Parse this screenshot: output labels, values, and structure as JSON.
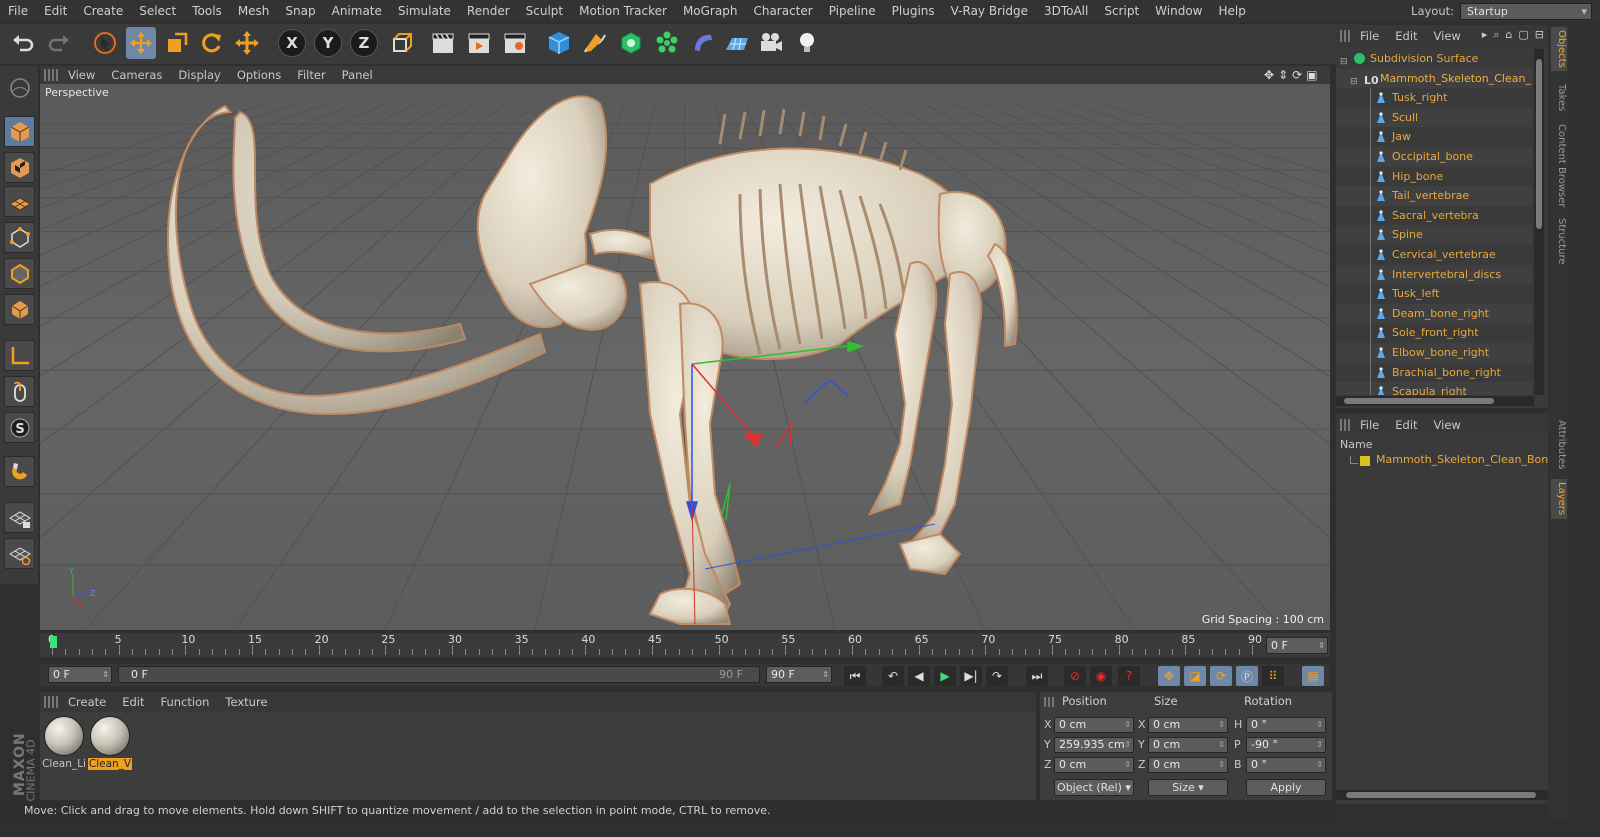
{
  "menubar": {
    "items": [
      "File",
      "Edit",
      "Create",
      "Select",
      "Tools",
      "Mesh",
      "Snap",
      "Animate",
      "Simulate",
      "Render",
      "Sculpt",
      "Motion Tracker",
      "MoGraph",
      "Character",
      "Pipeline",
      "Plugins",
      "V-Ray Bridge",
      "3DToAll",
      "Script",
      "Window",
      "Help"
    ],
    "layout_label": "Layout:",
    "layout_value": "Startup"
  },
  "toolbar": {
    "axis_x": "X",
    "axis_y": "Y",
    "axis_z": "Z"
  },
  "viewport": {
    "menu": [
      "View",
      "Cameras",
      "Display",
      "Options",
      "Filter",
      "Panel"
    ],
    "camera": "Perspective",
    "grid_spacing": "Grid Spacing : 100 cm",
    "axis_x": "X",
    "axis_y": "Y",
    "axis_z": "Z"
  },
  "timeline": {
    "ticks": [
      "0",
      "5",
      "10",
      "15",
      "20",
      "25",
      "30",
      "35",
      "40",
      "45",
      "50",
      "55",
      "60",
      "65",
      "70",
      "75",
      "80",
      "85",
      "90"
    ],
    "current_frame": "0 F"
  },
  "frames": {
    "start": "0 F",
    "slider_start": "0 F",
    "slider_end": "90 F",
    "end": "90 F"
  },
  "materials": {
    "menu": [
      "Create",
      "Edit",
      "Function",
      "Texture"
    ],
    "items": [
      {
        "name": "Clean_Li",
        "selected": false
      },
      {
        "name": "Clean_V",
        "selected": true
      }
    ]
  },
  "coords": {
    "headers": {
      "position": "Position",
      "size": "Size",
      "rotation": "Rotation"
    },
    "rows": [
      {
        "axis": "X",
        "pos": "0 cm",
        "size_axis": "X",
        "size": "0 cm",
        "rot_axis": "H",
        "rot": "0 °"
      },
      {
        "axis": "Y",
        "pos": "259.935 cm",
        "size_axis": "Y",
        "size": "0 cm",
        "rot_axis": "P",
        "rot": "-90 °"
      },
      {
        "axis": "Z",
        "pos": "0 cm",
        "size_axis": "Z",
        "size": "0 cm",
        "rot_axis": "B",
        "rot": "0 °"
      }
    ],
    "mode": "Object (Rel)",
    "size_mode": "Size",
    "apply": "Apply"
  },
  "status": "Move: Click and drag to move elements. Hold down SHIFT to quantize movement / add to the selection in point mode, CTRL to remove.",
  "brand": {
    "maxon": "MAXON",
    "product": "CINEMA 4D"
  },
  "objects": {
    "menu": [
      "File",
      "Edit",
      "View"
    ],
    "root": "Subdivision Surface",
    "group": "Mammoth_Skeleton_Clean_Bo",
    "children": [
      "Tusk_right",
      "Scull",
      "Jaw",
      "Occipital_bone",
      "Hip_bone",
      "Tail_vertebrae",
      "Sacral_vertebra",
      "Spine",
      "Cervical_vertebrae",
      "Intervertebral_discs",
      "Tusk_left",
      "Deam_bone_right",
      "Sole_front_right",
      "Elbow_bone_right",
      "Brachial_bone_right",
      "Scapula_right"
    ]
  },
  "layers": {
    "menu": [
      "File",
      "Edit",
      "View"
    ],
    "column": "Name",
    "item": "Mammoth_Skeleton_Clean_Bones",
    "layer_color": "#d6c41c"
  },
  "sidetabs": {
    "top": [
      "Objects",
      "Takes",
      "Content Browser",
      "Structure"
    ],
    "bottom": [
      "Attributes",
      "Layers"
    ]
  },
  "colors": {
    "accent": "#e8a83a",
    "selected_tool": "#6f88a8",
    "x_axis": "#e03030",
    "y_axis": "#30c030",
    "z_axis": "#3050e0"
  }
}
